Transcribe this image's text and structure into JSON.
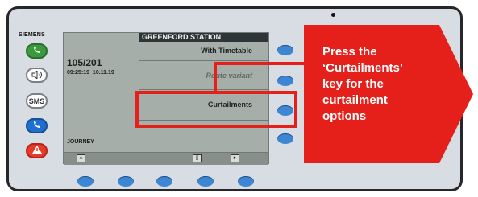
{
  "device": {
    "brand": "SIEMENS",
    "buttons": [
      {
        "icon": "phone-icon",
        "label": ""
      },
      {
        "icon": "speaker-icon",
        "label": ""
      },
      {
        "icon": "sms-icon",
        "label": "SMS"
      },
      {
        "icon": "phone-icon",
        "label": ""
      },
      {
        "icon": "alarm-triangle-icon",
        "label": ""
      }
    ]
  },
  "screen": {
    "station": "GREENFORD STATION",
    "menu": [
      {
        "label": "With Timetable"
      },
      {
        "label": "Route variant"
      },
      {
        "label": "Curtailments"
      }
    ],
    "train_number": "105/201",
    "time": "09:25:19",
    "date": "10.11.19",
    "footer_label": "JOURNEY"
  },
  "callout": {
    "text": "Press the\n‘Curtailments’\nkey for the\ncurtailment\noptions"
  },
  "colors": {
    "accent_red": "#e5201b",
    "softkey_blue": "#3d86d3",
    "screen_bg": "#a6aeaa",
    "device_bg": "#d7dde3"
  }
}
